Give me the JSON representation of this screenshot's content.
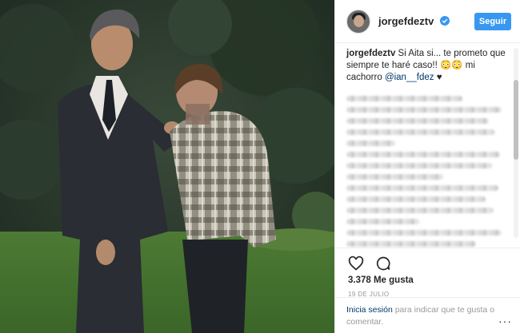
{
  "post": {
    "username": "jorgefdeztv",
    "follow_label": "Seguir",
    "caption_user": "jorgefdeztv",
    "caption_text": " Si Aita si... te prometo que siempre te haré caso!! 😳😳 mi cachorro ",
    "caption_mention": "@ian__fdez",
    "caption_end": " ♥",
    "likes": "3.378 Me gusta",
    "date": "19 DE JULIO",
    "login_link": "Inicia sesión",
    "login_text": " para indicar que te gusta o comentar.",
    "more_icon_text": "···"
  },
  "icons": {
    "like": "heart-icon",
    "comment": "comment-icon",
    "verified": "verified-badge-icon",
    "more": "more-options-icon"
  },
  "colors": {
    "follow_button": "#3897f0",
    "link": "#003569",
    "secondary_text": "#999999"
  }
}
